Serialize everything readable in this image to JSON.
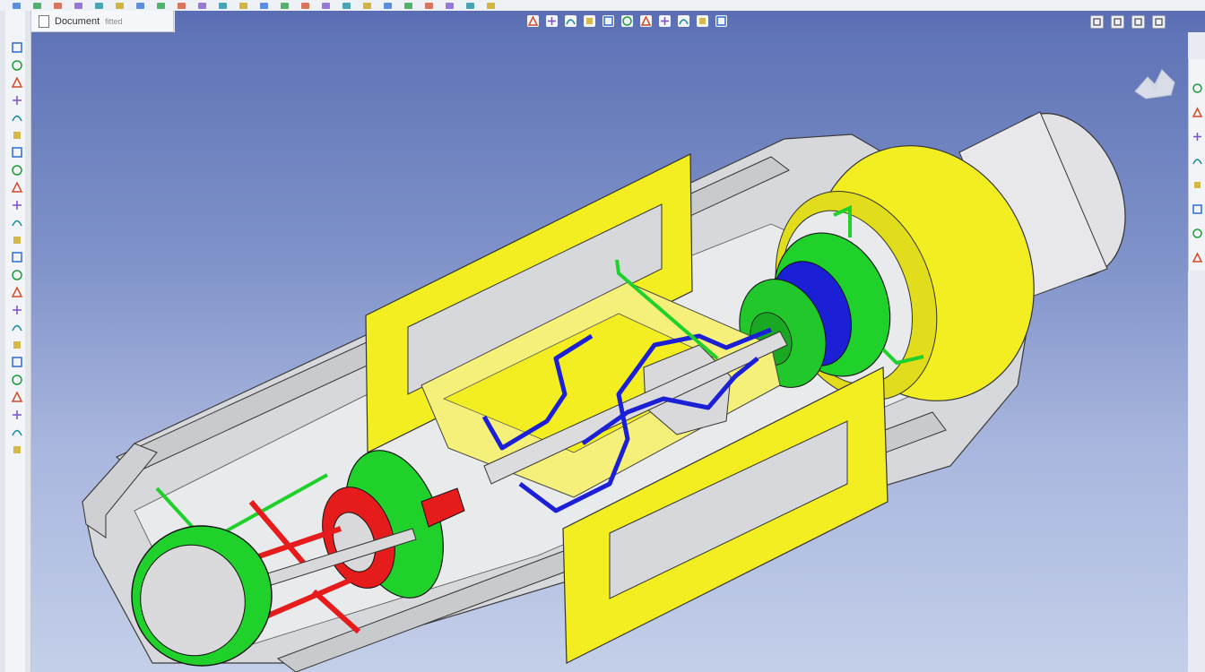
{
  "window": {
    "tab_label": "Document",
    "tab_suffix": "fitted"
  },
  "topbar": {
    "icons": [
      "file-icon",
      "open-icon",
      "save-icon",
      "print-icon",
      "undo-icon",
      "redo-icon",
      "select-icon",
      "rebuild-icon",
      "options-icon",
      "help-icon",
      "sketch-icon",
      "line-icon",
      "arc-icon",
      "spline-icon",
      "trim-icon",
      "extrude-icon",
      "revolve-icon",
      "sweep-icon",
      "loft-icon",
      "fillet-icon",
      "chamfer-icon",
      "shell-icon",
      "mirror-icon",
      "pattern-icon"
    ]
  },
  "left_toolbar": {
    "tools": [
      "new-part-icon",
      "sketch-icon",
      "smart-dimension-icon",
      "line-icon",
      "rectangle-icon",
      "circle-icon",
      "arc-icon",
      "polygon-icon",
      "spline-icon",
      "point-icon",
      "text-icon",
      "fillet-icon",
      "chamfer-icon",
      "offset-icon",
      "trim-icon",
      "extend-icon",
      "mirror-icon",
      "move-icon",
      "rotate-icon",
      "scale-icon",
      "pattern-icon",
      "relations-icon",
      "display-icon",
      "repair-icon"
    ]
  },
  "hud": {
    "tools": [
      "zoom-to-fit-icon",
      "zoom-area-icon",
      "previous-view-icon",
      "section-view-icon",
      "dynamic-annotation-icon",
      "view-orientation-icon",
      "display-style-icon",
      "hide-show-icon",
      "edit-appearance-icon",
      "apply-scene-icon",
      "view-settings-icon"
    ],
    "window_controls": [
      "restore-icon",
      "tile-icon",
      "minimize-icon",
      "close-icon"
    ]
  },
  "right_toolbar": {
    "tools": [
      "resources-icon",
      "design-library-icon",
      "file-explorer-icon",
      "search-icon",
      "appearances-icon",
      "custom-properties-icon",
      "view-palette-icon",
      "forum-icon"
    ]
  },
  "colors": {
    "viewport_top": "#5f73b7",
    "viewport_bottom": "#c4cfe9",
    "frame_yellow": "#f2ee22",
    "flange_green": "#1fd12a",
    "red_part": "#e61c1c",
    "blue_tube": "#1b1fd6",
    "housing_gray": "#d9dadc"
  }
}
